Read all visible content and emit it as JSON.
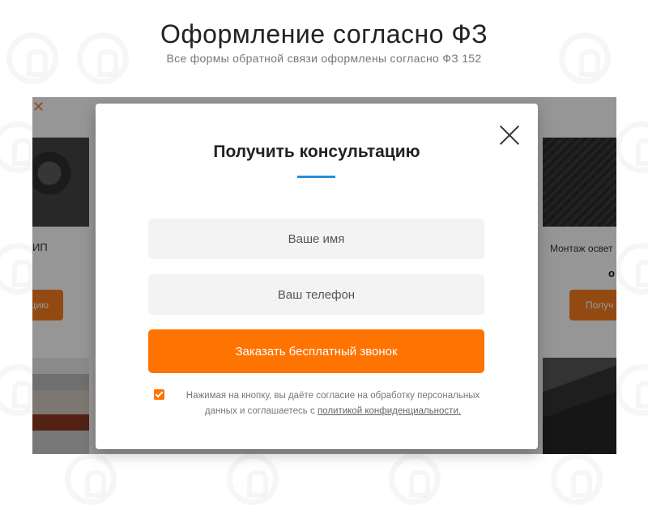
{
  "header": {
    "title": "Оформление согласно ФЗ",
    "subtitle": "Все формы обратной связи оформлены согласно ФЗ 152"
  },
  "background": {
    "left_card_text": "ИП",
    "left_button_label": "цию",
    "right_card_text": "Монтаж освет",
    "right_price_text": "о",
    "right_button_label": "Получ"
  },
  "modal": {
    "title": "Получить консультацию",
    "name_placeholder": "Ваше имя",
    "phone_placeholder": "Ваш телефон",
    "submit_label": "Заказать бесплатный звонок",
    "consent_text": "Нажимая на кнопку, вы даёте согласие на обработку персональных данных и соглашаетесь с",
    "consent_link": "политикой конфиденциальности.",
    "checkbox_checked": true
  },
  "colors": {
    "accent": "#ff7301",
    "underline": "#2a8fd4"
  }
}
